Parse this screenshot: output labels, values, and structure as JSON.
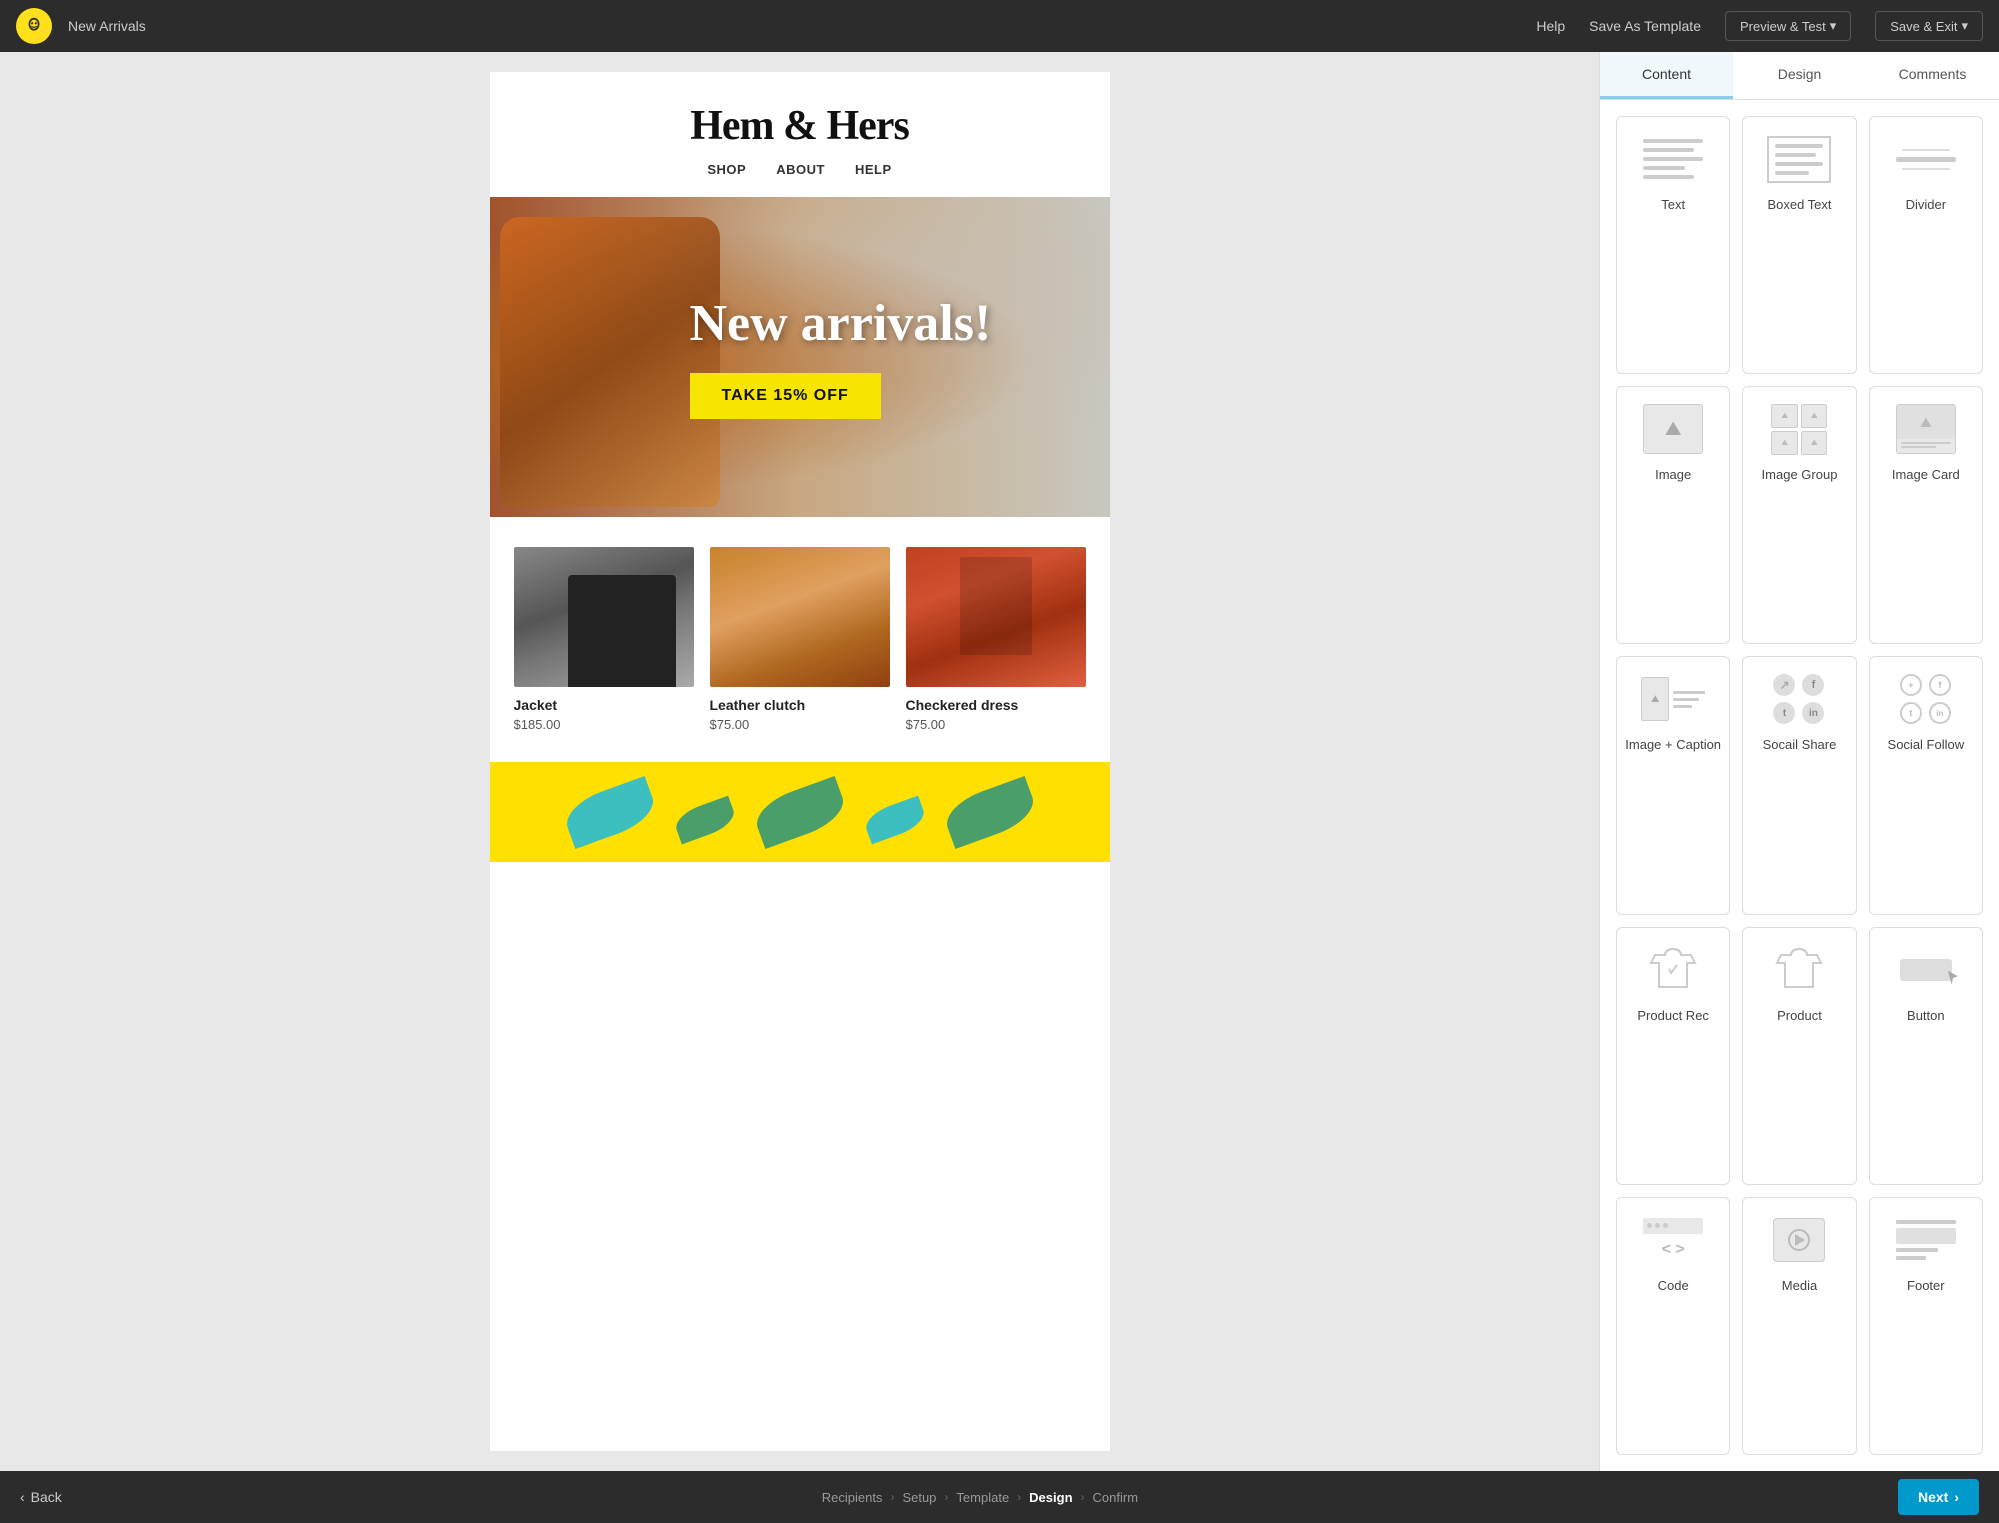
{
  "topbar": {
    "app_name": "New Arrivals",
    "help_label": "Help",
    "save_template_label": "Save As Template",
    "preview_label": "Preview & Test",
    "save_exit_label": "Save & Exit"
  },
  "email": {
    "brand": "Hem & Hers",
    "nav": [
      "SHOP",
      "ABOUT",
      "HELP"
    ],
    "hero": {
      "title": "New arrivals!",
      "cta_label": "TAKE 15% OFF"
    },
    "products": [
      {
        "name": "Jacket",
        "price": "$185.00"
      },
      {
        "name": "Leather clutch",
        "price": "$75.00"
      },
      {
        "name": "Checkered dress",
        "price": "$75.00"
      }
    ]
  },
  "panel": {
    "tabs": [
      {
        "label": "Content",
        "active": true
      },
      {
        "label": "Design",
        "active": false
      },
      {
        "label": "Comments",
        "active": false
      }
    ],
    "blocks": [
      {
        "id": "text",
        "label": "Text"
      },
      {
        "id": "boxed-text",
        "label": "Boxed Text"
      },
      {
        "id": "divider",
        "label": "Divider"
      },
      {
        "id": "image",
        "label": "Image"
      },
      {
        "id": "image-group",
        "label": "Image Group"
      },
      {
        "id": "image-card",
        "label": "Image Card"
      },
      {
        "id": "image-caption",
        "label": "Image + Caption"
      },
      {
        "id": "social-share",
        "label": "Socail Share"
      },
      {
        "id": "social-follow",
        "label": "Social Follow"
      },
      {
        "id": "product-rec",
        "label": "Product Rec"
      },
      {
        "id": "product",
        "label": "Product"
      },
      {
        "id": "button",
        "label": "Button"
      },
      {
        "id": "code",
        "label": "Code"
      },
      {
        "id": "media",
        "label": "Media"
      },
      {
        "id": "footer",
        "label": "Footer"
      }
    ]
  },
  "bottombar": {
    "back_label": "Back",
    "breadcrumb": [
      {
        "label": "Recipients",
        "active": false
      },
      {
        "label": "Setup",
        "active": false
      },
      {
        "label": "Template",
        "active": false
      },
      {
        "label": "Design",
        "active": true
      },
      {
        "label": "Confirm",
        "active": false
      }
    ],
    "next_label": "Next"
  }
}
